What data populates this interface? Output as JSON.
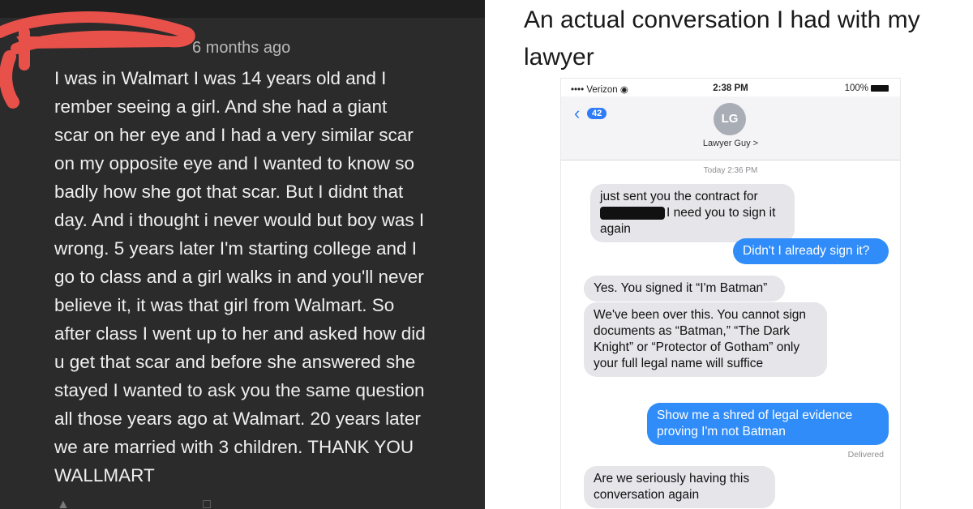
{
  "comment": {
    "timestamp": "6 months ago",
    "lines": [
      "I was in Walmart I was 14 years old and I",
      "rember seeing a girl. And she had a giant",
      "scar on her eye and I had a very similar scar",
      "on my opposite eye and I wanted to know so",
      "badly how she got that scar. But I didnt that",
      "day. And i thought i never would but boy was I",
      "wrong. 5 years later I'm starting college and I",
      "go to class and a girl walks in and you'll never",
      "believe it, it was that girl from Walmart. So",
      "after class I went up to her and asked how did",
      "u get that scar and before she answered she",
      "stayed I wanted to ask you the same question",
      "all those years ago at Walmart. 20 years later",
      "we are married with 3 children. THANK YOU",
      "WALLMART"
    ],
    "redaction_color": "#e8504a"
  },
  "meme": {
    "caption": "An actual conversation I had with my lawyer"
  },
  "phone": {
    "carrier": "Verizon",
    "time": "2:38 PM",
    "battery": "100%",
    "back_badge": "42",
    "contact_initials": "LG",
    "contact_name": "Lawyer Guy >",
    "timestamp": "Today 2:36 PM",
    "delivered": "Delivered",
    "messages": [
      {
        "from": "them",
        "text_before": "just sent you the contract for",
        "text_after": "I need you to sign it again"
      },
      {
        "from": "me",
        "text": "Didn't I already sign it?"
      },
      {
        "from": "them",
        "text": "Yes. You signed it “I'm Batman”"
      },
      {
        "from": "them",
        "text": "We've been over this. You cannot sign documents as “Batman,” “The Dark Knight” or “Protector of Gotham” only your full legal name will suffice"
      },
      {
        "from": "me",
        "text": "Show me a shred of legal evidence proving I'm not Batman"
      },
      {
        "from": "them",
        "text": "Are we seriously having this conversation again"
      }
    ],
    "colors": {
      "sent": "#2f8cf9",
      "received": "#e5e5ea",
      "accent": "#2f7cf6"
    }
  }
}
